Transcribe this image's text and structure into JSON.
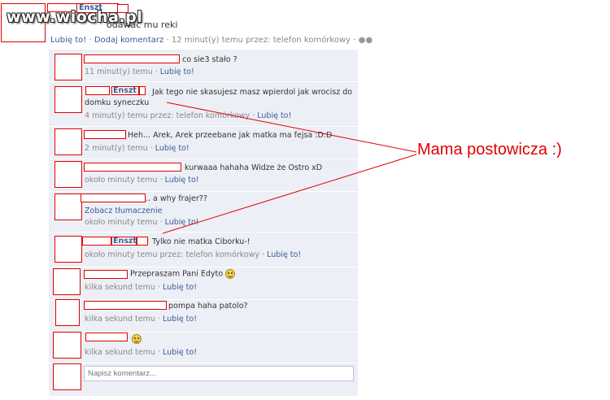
{
  "watermark": "www.wiocha.pl",
  "post": {
    "name_fragment": "Enszt",
    "text": "odawac mu reki",
    "like_label": "Lubię to!",
    "comment_label": "Dodaj komentarz",
    "time_via": "12 minut(y) temu przez: telefon komórkowy",
    "separator": "·"
  },
  "comments": [
    {
      "text": "co sie3 stało ?",
      "meta": "11 minut(y) temu",
      "like": "Lubię to!"
    },
    {
      "name": "Enszt",
      "text": "Jak tego nie skasujesz masz wpierdol jak wrocisz do",
      "text2": "domku syneczku",
      "meta": "4 minut(y) temu przez: telefon komórkowy",
      "like": "Lubię to!"
    },
    {
      "text": "Heh... Arek, Arek przeebane jak matka ma fejsa :D:D",
      "meta": "2 minut(y) temu",
      "like": "Lubię to!"
    },
    {
      "text": "kurwaaa hahaha Widze że Ostro xD",
      "meta": "około minuty temu",
      "like": "Lubię to!"
    },
    {
      "text": ".. a why frajer??",
      "translate": "Zobacz tłumaczenie",
      "meta": "około minuty temu",
      "like": "Lubię to!"
    },
    {
      "name": "Enszt",
      "text": "Tylko nie matka Ciborku-!",
      "meta": "około minuty temu przez: telefon komórkowy",
      "like": "Lubię to!"
    },
    {
      "text": "Przepraszam Pani Edyto",
      "meta": "kilka sekund temu",
      "like": "Lubię to!"
    },
    {
      "text": "pompa haha patolo?",
      "meta": "kilka sekund temu",
      "like": "Lubię to!"
    },
    {
      "text": "",
      "meta": "kilka sekund temu",
      "like": "Lubię to!"
    }
  ],
  "comment_input": {
    "placeholder": "Napisz komentarz..."
  },
  "annotation": "Mama postowicza :)",
  "colors": {
    "annotation": "#e00000",
    "link": "#3b5998",
    "comment_bg": "#eceff5"
  }
}
